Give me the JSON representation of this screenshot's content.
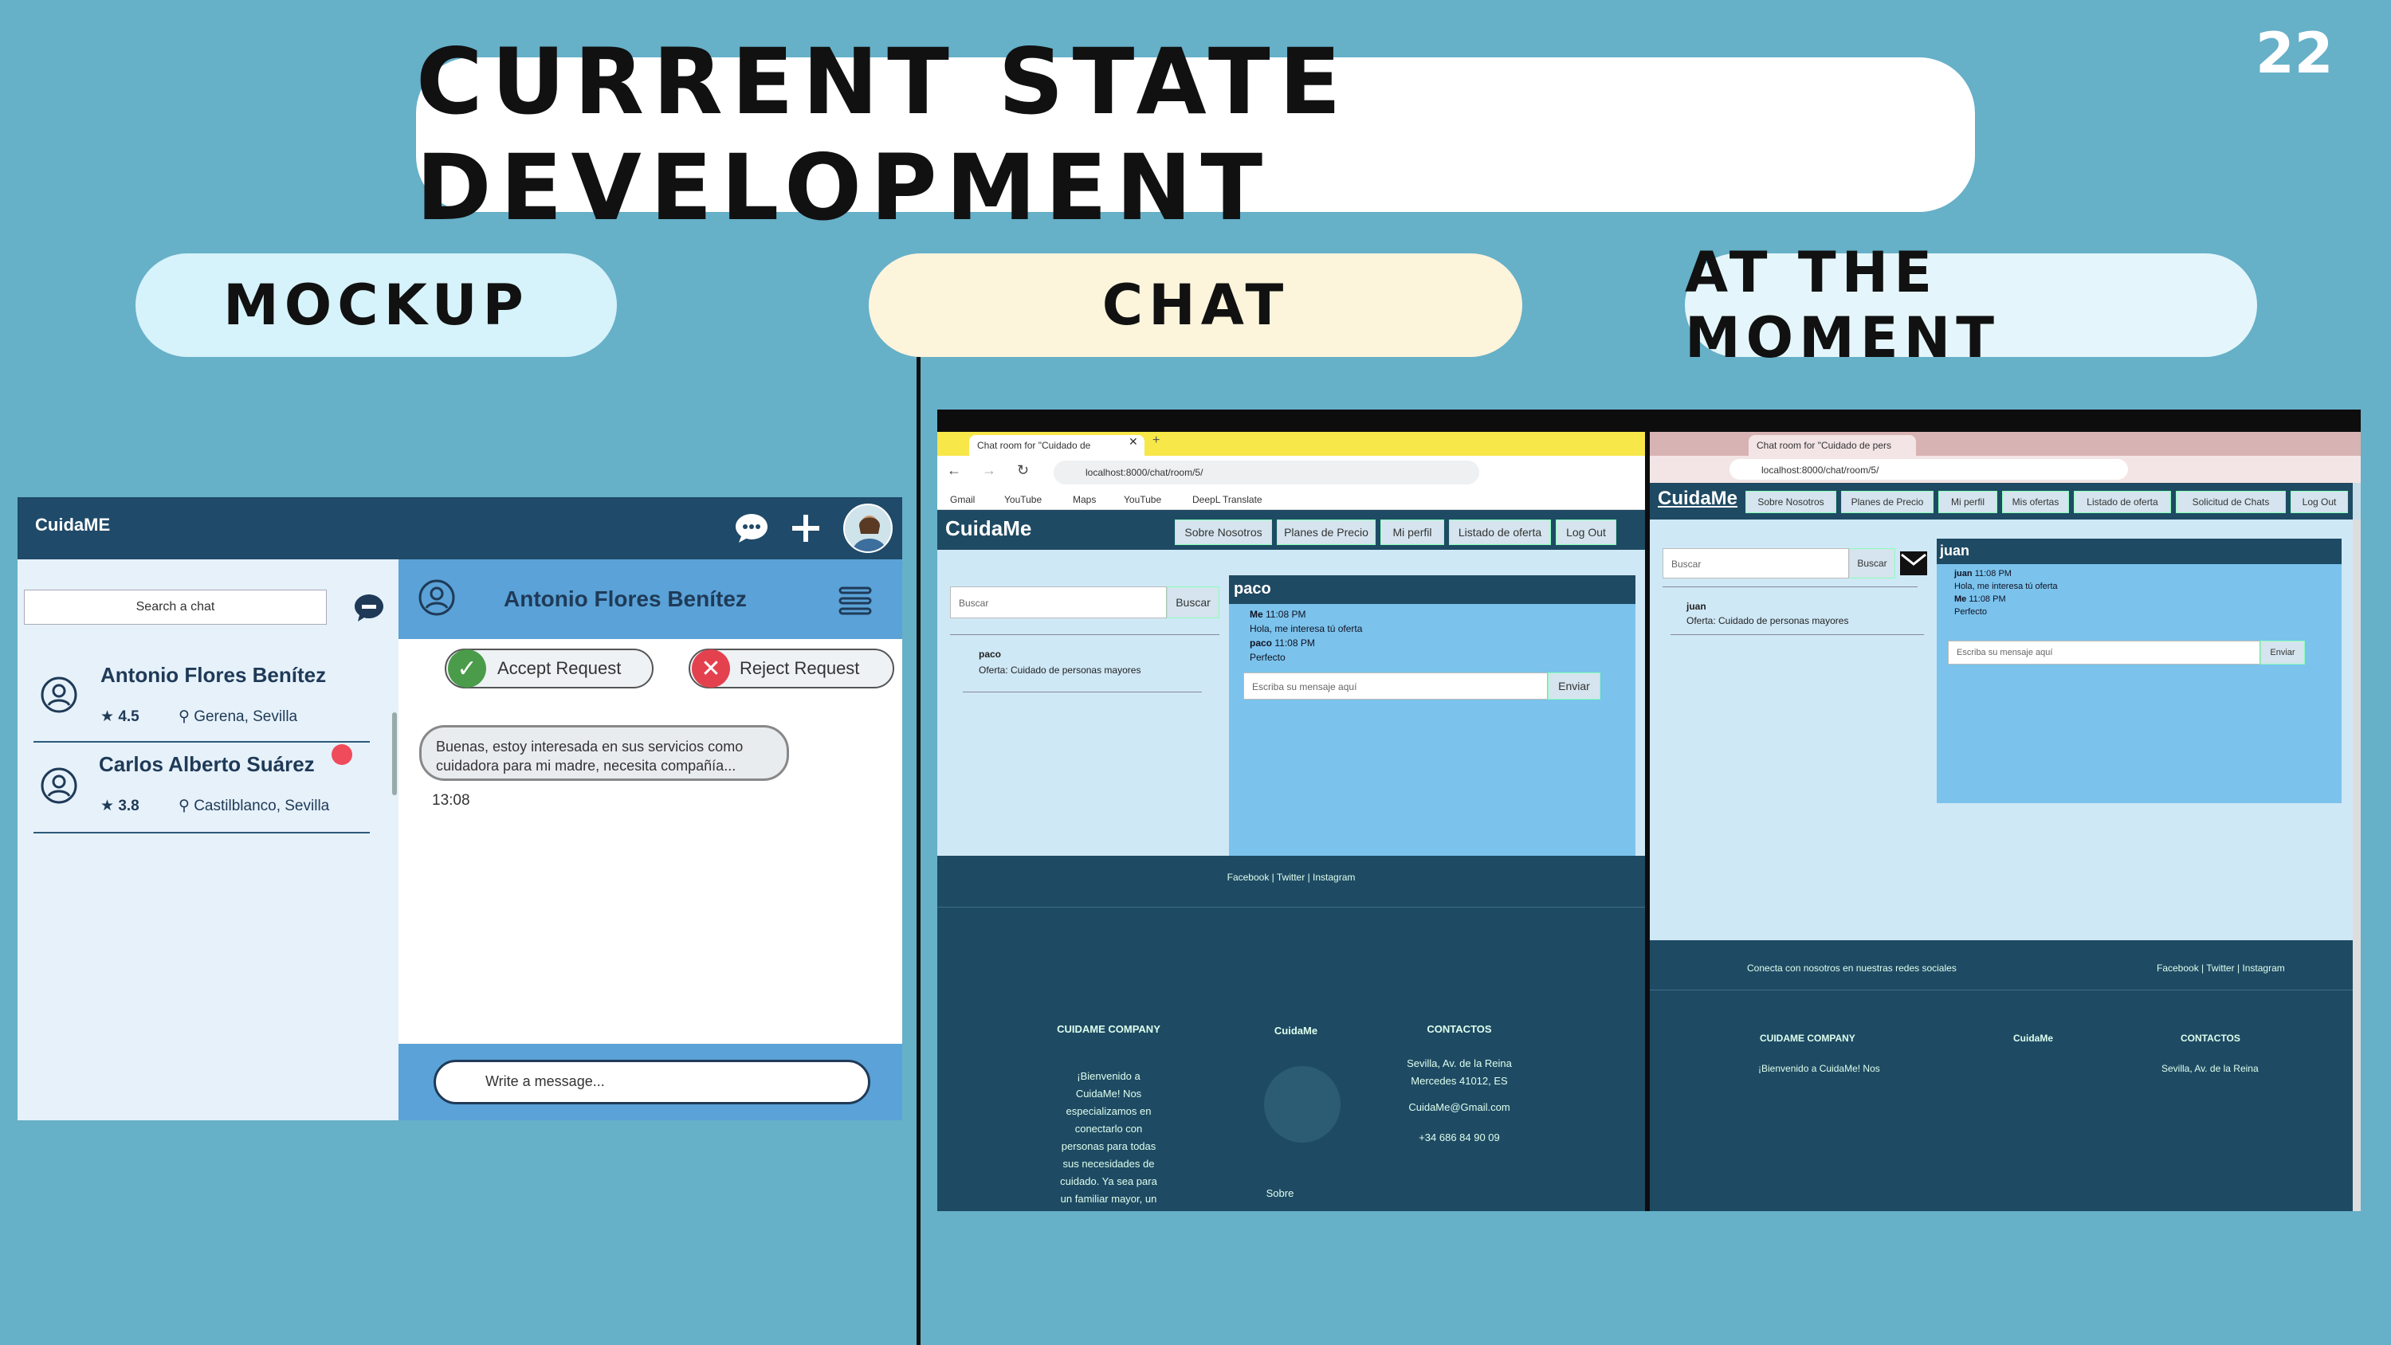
{
  "title": "CURRENT STATE DEVELOPMENT",
  "page_number": "22",
  "labels": {
    "mockup": "MOCKUP",
    "chat": "CHAT",
    "moment": "AT THE MOMENT"
  },
  "mockup": {
    "brand": "CuidaME",
    "search_placeholder": "Search a chat",
    "contacts": [
      {
        "name": "Antonio Flores Benítez",
        "rating": "4.5",
        "location": "Gerena, Sevilla"
      },
      {
        "name": "Carlos Alberto Suárez",
        "rating": "3.8",
        "location": "Castilblanco, Sevilla"
      }
    ],
    "header_name": "Antonio Flores Benítez",
    "accept": "Accept Request",
    "reject": "Reject Request",
    "message": "Buenas, estoy interesada en sus servicios como cuidadora para mi madre, necesita compañía...",
    "time": "13:08",
    "write_placeholder": "Write a message..."
  },
  "left_browser": {
    "tab": "Chat room for \"Cuidado de",
    "url": "localhost:8000/chat/room/5/",
    "bookmarks": [
      "Gmail",
      "YouTube",
      "Maps",
      "YouTube",
      "DeepL Translate"
    ],
    "brand": "CuidaMe",
    "nav": [
      "Sobre Nosotros",
      "Planes de Precio",
      "Mi perfil",
      "Listado de oferta",
      "Log Out"
    ],
    "search_placeholder": "Buscar",
    "search_button": "Buscar",
    "room_user": "paco",
    "room_offer": "Oferta: Cuidado de personas mayores",
    "chat_title": "paco",
    "messages": [
      {
        "who": "Me",
        "time": "11:08 PM",
        "text": "Hola, me interesa tú oferta"
      },
      {
        "who": "paco",
        "time": "11:08 PM",
        "text": "Perfecto"
      }
    ],
    "input_placeholder": "Escriba su mensaje aquí",
    "send": "Enviar",
    "social": "Facebook | Twitter | Instagram",
    "footer_company": "CUIDAME COMPANY",
    "footer_brand": "CuidaMe",
    "footer_contacts": "CONTACTOS",
    "footer_about": "¡Bienvenido a CuidaMe! Nos especializamos en conectarlo con personas para todas sus necesidades de cuidado. Ya sea para un familiar mayor, un",
    "footer_address": "Sevilla, Av. de la Reina Mercedes 41012, ES",
    "footer_email": "CuidaMe@Gmail.com",
    "footer_phone": "+34 686 84 90 09",
    "footer_sobre": "Sobre"
  },
  "right_browser": {
    "tab": "Chat room for \"Cuidado de pers",
    "url": "localhost:8000/chat/room/5/",
    "brand": "CuidaMe",
    "nav": [
      "Sobre Nosotros",
      "Planes de Precio",
      "Mi perfil",
      "Mis ofertas",
      "Listado de oferta",
      "Solicitud de Chats",
      "Log Out"
    ],
    "search_placeholder": "Buscar",
    "search_button": "Buscar",
    "room_user": "juan",
    "room_offer": "Oferta: Cuidado de personas mayores",
    "chat_title": "juan",
    "messages": [
      {
        "who": "juan",
        "time": "11:08 PM",
        "text": "Hola, me interesa tú oferta"
      },
      {
        "who": "Me",
        "time": "11:08 PM",
        "text": "Perfecto"
      }
    ],
    "input_placeholder": "Escriba su mensaje aquí",
    "send": "Enviar",
    "connect": "Conecta con nosotros en nuestras redes sociales",
    "social": "Facebook | Twitter | Instagram",
    "footer_company": "CUIDAME COMPANY",
    "footer_brand": "CuidaMe",
    "footer_contacts": "CONTACTOS",
    "footer_welcome": "¡Bienvenido a CuidaMe! Nos",
    "footer_address": "Sevilla, Av. de la Reina"
  }
}
